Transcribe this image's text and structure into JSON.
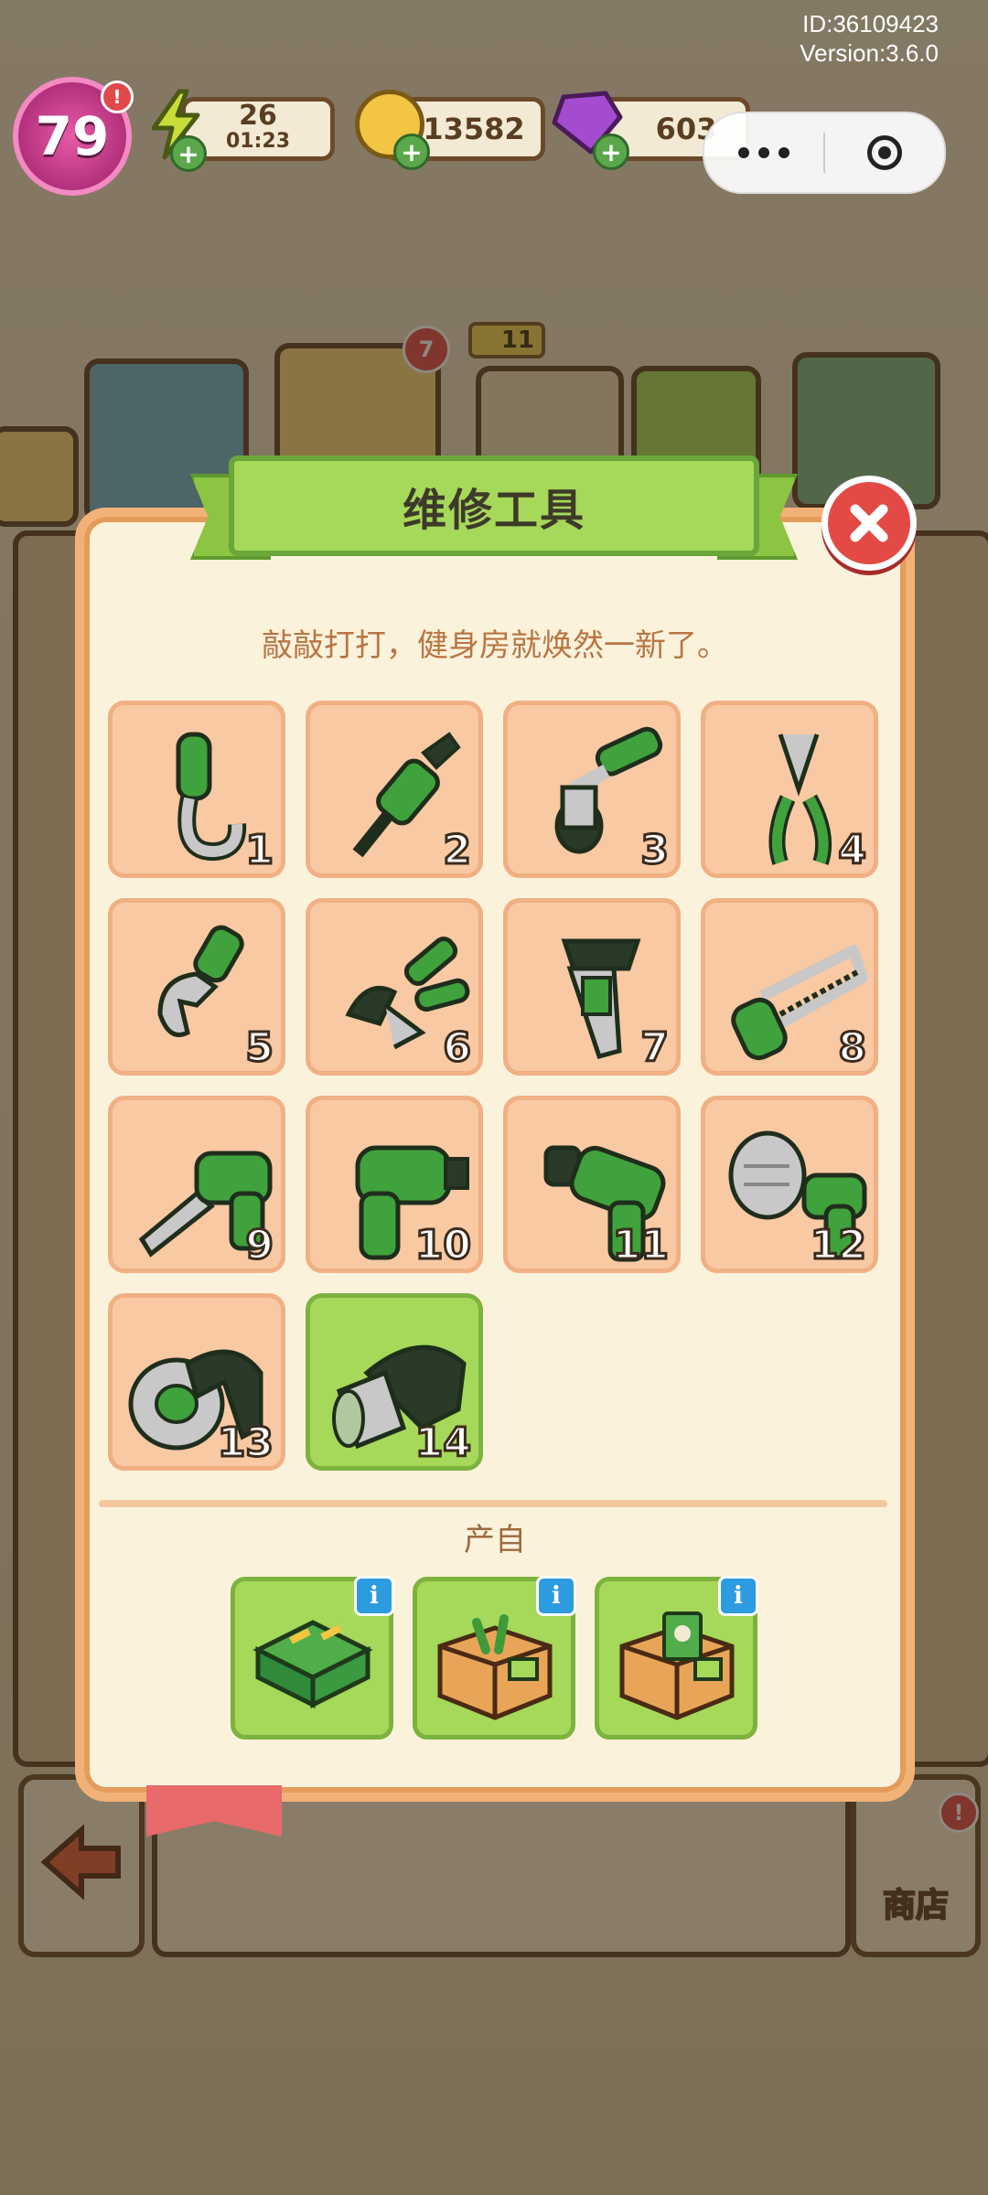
{
  "hud": {
    "account_id": "ID:36109423",
    "version": "Version:3.6.0",
    "level": "79",
    "energy_value": "26",
    "energy_timer": "01:23",
    "coins": "13582",
    "gems": "603",
    "exclaim": "!"
  },
  "background": {
    "card_badge": "7",
    "star_count": "11",
    "shop_label": "商店"
  },
  "modal": {
    "title": "维修工具",
    "subtitle": "敲敲打打，健身房就焕然一新了。",
    "items": [
      {
        "num": "1",
        "icon": "pipe-hook-icon"
      },
      {
        "num": "2",
        "icon": "screwdriver-icon"
      },
      {
        "num": "3",
        "icon": "socket-wrench-icon"
      },
      {
        "num": "4",
        "icon": "pliers-icon"
      },
      {
        "num": "5",
        "icon": "adjustable-wrench-icon"
      },
      {
        "num": "6",
        "icon": "wire-cutter-icon"
      },
      {
        "num": "7",
        "icon": "pipe-wrench-icon"
      },
      {
        "num": "8",
        "icon": "hacksaw-icon"
      },
      {
        "num": "9",
        "icon": "saw-drill-icon"
      },
      {
        "num": "10",
        "icon": "power-drill-icon"
      },
      {
        "num": "11",
        "icon": "hammer-drill-icon"
      },
      {
        "num": "12",
        "icon": "hole-saw-drill-icon"
      },
      {
        "num": "13",
        "icon": "angle-grinder-icon"
      },
      {
        "num": "14",
        "icon": "heat-gun-icon"
      }
    ],
    "selected_item": "14",
    "from_label": "产自",
    "sources": [
      {
        "icon": "green-toolbox-icon",
        "info": "i"
      },
      {
        "icon": "tool-crate-icon",
        "info": "i"
      },
      {
        "icon": "supply-crate-icon",
        "info": "i"
      }
    ]
  },
  "colors": {
    "accent_green": "#a6d85a",
    "tile_peach": "#f8c9a3",
    "close_red": "#e34a45",
    "info_blue": "#2d9be0"
  }
}
